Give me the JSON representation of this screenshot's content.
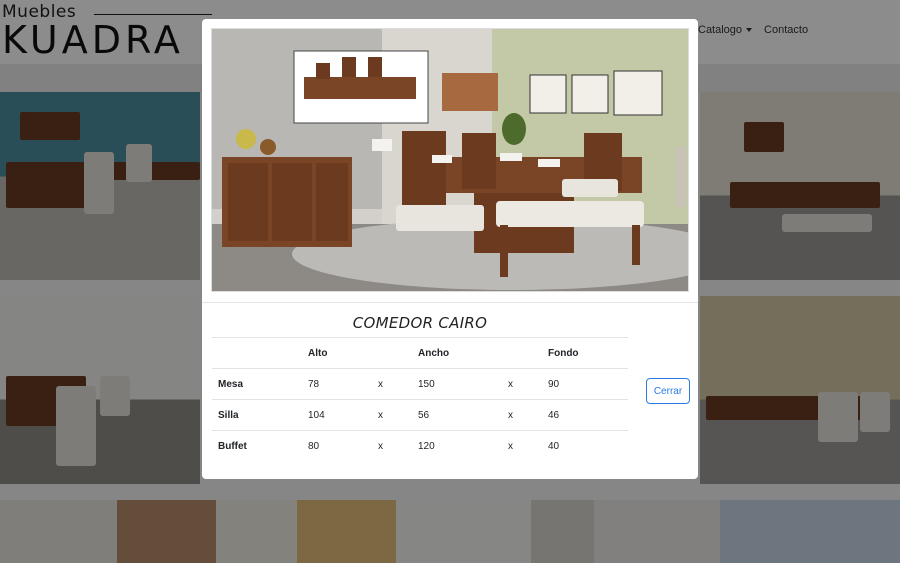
{
  "brand": {
    "top": "Muebles",
    "name": "KUADRA"
  },
  "nav": {
    "catalog": "Catalogo",
    "contact": "Contacto"
  },
  "modal": {
    "title": "COMEDOR CAIRO",
    "image_alt": "Comedor Cairo",
    "columns": [
      "",
      "Alto",
      "",
      "Ancho",
      "",
      "Fondo"
    ],
    "rows": [
      {
        "name": "Mesa",
        "alto": "78",
        "sep1": "x",
        "ancho": "150",
        "sep2": "x",
        "fondo": "90"
      },
      {
        "name": "Silla",
        "alto": "104",
        "sep1": "x",
        "ancho": "56",
        "sep2": "x",
        "fondo": "46"
      },
      {
        "name": "Buffet",
        "alto": "80",
        "sep1": "x",
        "ancho": "120",
        "sep2": "x",
        "fondo": "40"
      }
    ],
    "close_label": "Cerrar"
  },
  "colors": {
    "accent": "#2a7ce2",
    "wood": "#6a3b22"
  }
}
